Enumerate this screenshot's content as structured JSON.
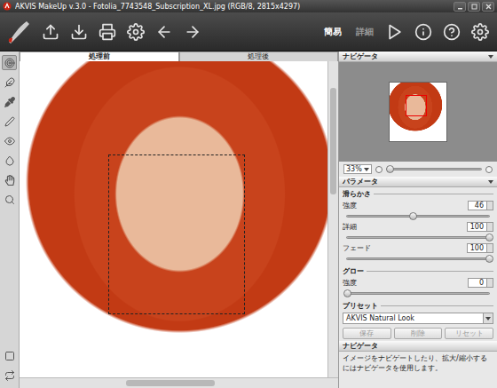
{
  "window": {
    "title": "AKVIS MakeUp v.3.0 - Fotolia_7743548_Subscription_XL.jpg (RGB/8, 2815x4297)"
  },
  "toolbar": {
    "modes": [
      {
        "label": "簡易",
        "selected": true
      },
      {
        "label": "詳細",
        "selected": false
      }
    ]
  },
  "tools": [
    {
      "selected": true
    },
    {
      "selected": false
    },
    {
      "selected": false
    },
    {
      "selected": false
    },
    {
      "selected": false
    },
    {
      "selected": false
    },
    {
      "selected": false
    },
    {
      "selected": false
    },
    {
      "selected": false
    },
    {
      "selected": false
    }
  ],
  "tabs": [
    {
      "label": "処理前",
      "selected": true
    },
    {
      "label": "処理後",
      "selected": false
    }
  ],
  "navigator": {
    "title": "ナビゲータ",
    "zoom": "33%",
    "level": 0.03
  },
  "parameters": {
    "title": "パラメータ",
    "groups": [
      {
        "title": "滑らかさ",
        "sliders": [
          {
            "label": "強度",
            "value": "46",
            "level": 0.46
          },
          {
            "label": "詳細",
            "value": "100",
            "level": 1
          },
          {
            "label": "フェード",
            "value": "100",
            "level": 1
          }
        ]
      },
      {
        "title": "グロー",
        "sliders": [
          {
            "label": "強度",
            "value": "0",
            "level": 0
          }
        ]
      }
    ]
  },
  "preset": {
    "title": "プリセット",
    "value": "AKVIS Natural Look",
    "buttons": [
      {
        "label": "保存",
        "disabled": true
      },
      {
        "label": "削除",
        "disabled": true
      },
      {
        "label": "リセット",
        "disabled": true
      }
    ]
  },
  "help": {
    "title": "ナビゲータ",
    "text": "イメージをナビゲートしたり、拡大/縮小するにはナビゲータを使用します。"
  }
}
